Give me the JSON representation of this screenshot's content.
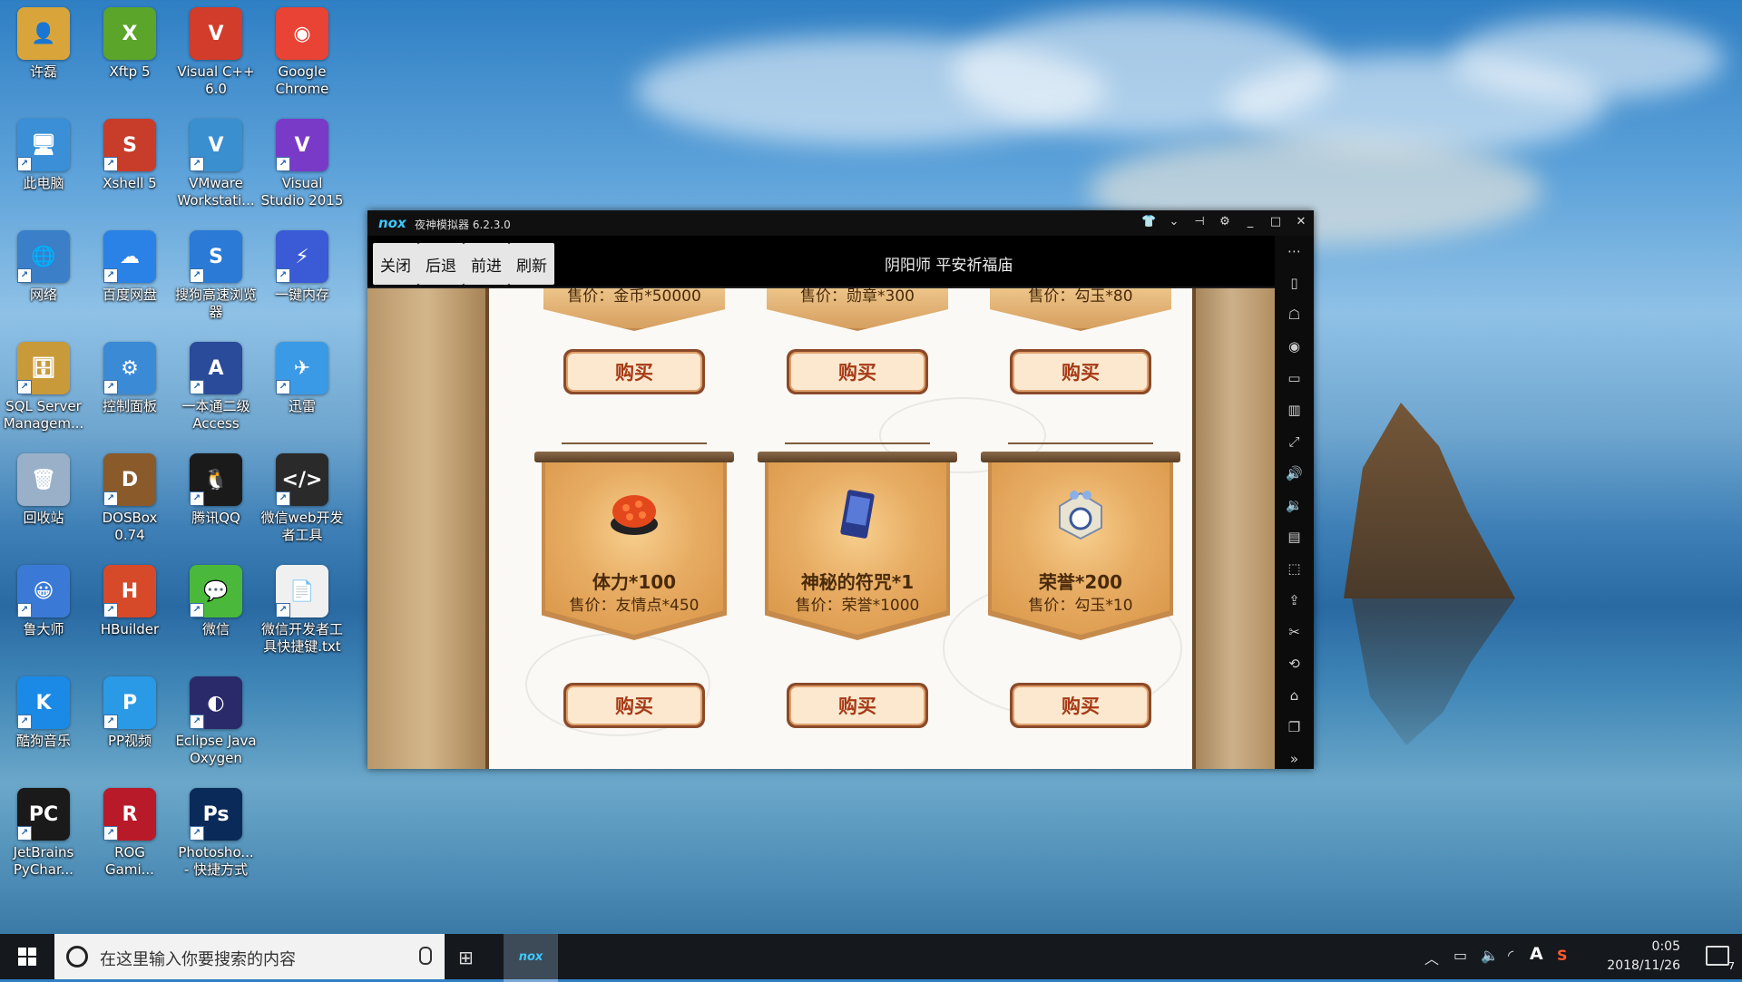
{
  "desktop": {
    "icons": [
      {
        "label": "许磊",
        "color": "#d9a53a"
      },
      {
        "label": "Xftp 5",
        "color": "#5aa52a"
      },
      {
        "label": "Visual C++ 6.0",
        "color": "#d23c2a"
      },
      {
        "label": "Google Chrome",
        "color": "#e84335"
      },
      {
        "label": "此电脑",
        "color": "#3a8fd6"
      },
      {
        "label": "Xshell 5",
        "color": "#c83c2a"
      },
      {
        "label": "VMware Workstati...",
        "color": "#3a8fcf"
      },
      {
        "label": "Visual Studio 2015",
        "color": "#7a3ac8"
      },
      {
        "label": "网络",
        "color": "#3a7fc8"
      },
      {
        "label": "百度网盘",
        "color": "#2a82e6"
      },
      {
        "label": "搜狗高速浏览器",
        "color": "#2a7ad6"
      },
      {
        "label": "一键内存",
        "color": "#3a5ad6"
      },
      {
        "label": "SQL Server Managem...",
        "color": "#c89a3a"
      },
      {
        "label": "控制面板",
        "color": "#3a8ad6"
      },
      {
        "label": "一本通二级Access",
        "color": "#2a4a9a"
      },
      {
        "label": "迅雷",
        "color": "#3a9ae6"
      },
      {
        "label": "回收站",
        "color": "#9ab0c8"
      },
      {
        "label": "DOSBox 0.74",
        "color": "#8a5a2a"
      },
      {
        "label": "腾讯QQ",
        "color": "#1a1a1a"
      },
      {
        "label": "微信web开发者工具",
        "color": "#2a2a2a"
      },
      {
        "label": "鲁大师",
        "color": "#3a7ad6"
      },
      {
        "label": "HBuilder",
        "color": "#d64a2a"
      },
      {
        "label": "微信",
        "color": "#4ab83a"
      },
      {
        "label": "微信开发者工具快捷键.txt",
        "color": "#f0f0f0"
      },
      {
        "label": "酷狗音乐",
        "color": "#1a8ae6"
      },
      {
        "label": "PP视频",
        "color": "#2a9ae6"
      },
      {
        "label": "Eclipse Java Oxygen",
        "color": "#2a2a6a"
      },
      {
        "label": "",
        "color": "#00000000"
      },
      {
        "label": "JetBrains PyChar...",
        "color": "#1a1a1a"
      },
      {
        "label": "ROG Gami...",
        "color": "#b81a2a"
      },
      {
        "label": "Photosho... - 快捷方式",
        "color": "#0a2a5a"
      }
    ],
    "icon_glyphs": [
      "👤",
      "X",
      "V",
      "◉",
      "🖥",
      "S",
      "V",
      "V",
      "🌐",
      "☁",
      "S",
      "⚡",
      "🗄",
      "⚙",
      "A",
      "✈",
      "🗑",
      "D",
      "🐧",
      "</>",
      "😀",
      "H",
      "💬",
      "📄",
      "K",
      "P",
      "◐",
      "",
      "PC",
      "R",
      "Ps"
    ]
  },
  "window": {
    "brand": "nox",
    "title": "夜神模拟器 6.2.3.0",
    "controls": [
      "shirt-icon",
      "chevron-down-icon",
      "pin-icon",
      "gear-icon",
      "minimize-icon",
      "maximize-icon",
      "close-icon"
    ],
    "control_glyphs": [
      "👕",
      "⌄",
      "⊣",
      "⚙",
      "_",
      "□",
      "✕"
    ],
    "toolbar": {
      "close": "关闭",
      "back": "后退",
      "forward": "前进",
      "refresh": "刷新",
      "page_title": "阴阳师 平安祈福庙"
    },
    "shop": {
      "top_prices": [
        "售价：金币*50000",
        "售价：勋章*300",
        "售价：勾玉*80"
      ],
      "buy_label": "购买",
      "items": [
        {
          "name": "体力*100",
          "price": "售价：友情点*450",
          "icon": "sushi-icon"
        },
        {
          "name": "神秘的符咒*1",
          "price": "售价：荣誉*1000",
          "icon": "talisman-icon"
        },
        {
          "name": "荣誉*200",
          "price": "售价：勾玉*10",
          "icon": "honor-badge-icon"
        }
      ]
    },
    "sidebar": {
      "icons": [
        "more-icon",
        "shake-icon",
        "robot-icon",
        "location-icon",
        "keyboard-icon",
        "phone-icon",
        "fullscreen-icon",
        "volume-up-icon",
        "volume-down-icon",
        "apk-icon",
        "screenshot-icon",
        "upload-icon",
        "scissors-icon",
        "rotate-icon",
        "home-icon",
        "recent-apps-icon",
        "expand-icon"
      ],
      "glyphs": [
        "⋯",
        "▯",
        "☖",
        "◉",
        "▭",
        "▥",
        "⤢",
        "🔊",
        "🔉",
        "▤",
        "⬚",
        "⇪",
        "✂",
        "⟲",
        "⌂",
        "❐",
        "»"
      ]
    }
  },
  "taskbar": {
    "search_placeholder": "在这里输入你要搜索的内容",
    "time": "0:05",
    "date": "2018/11/26",
    "notification_count": "7",
    "ime": "A"
  }
}
